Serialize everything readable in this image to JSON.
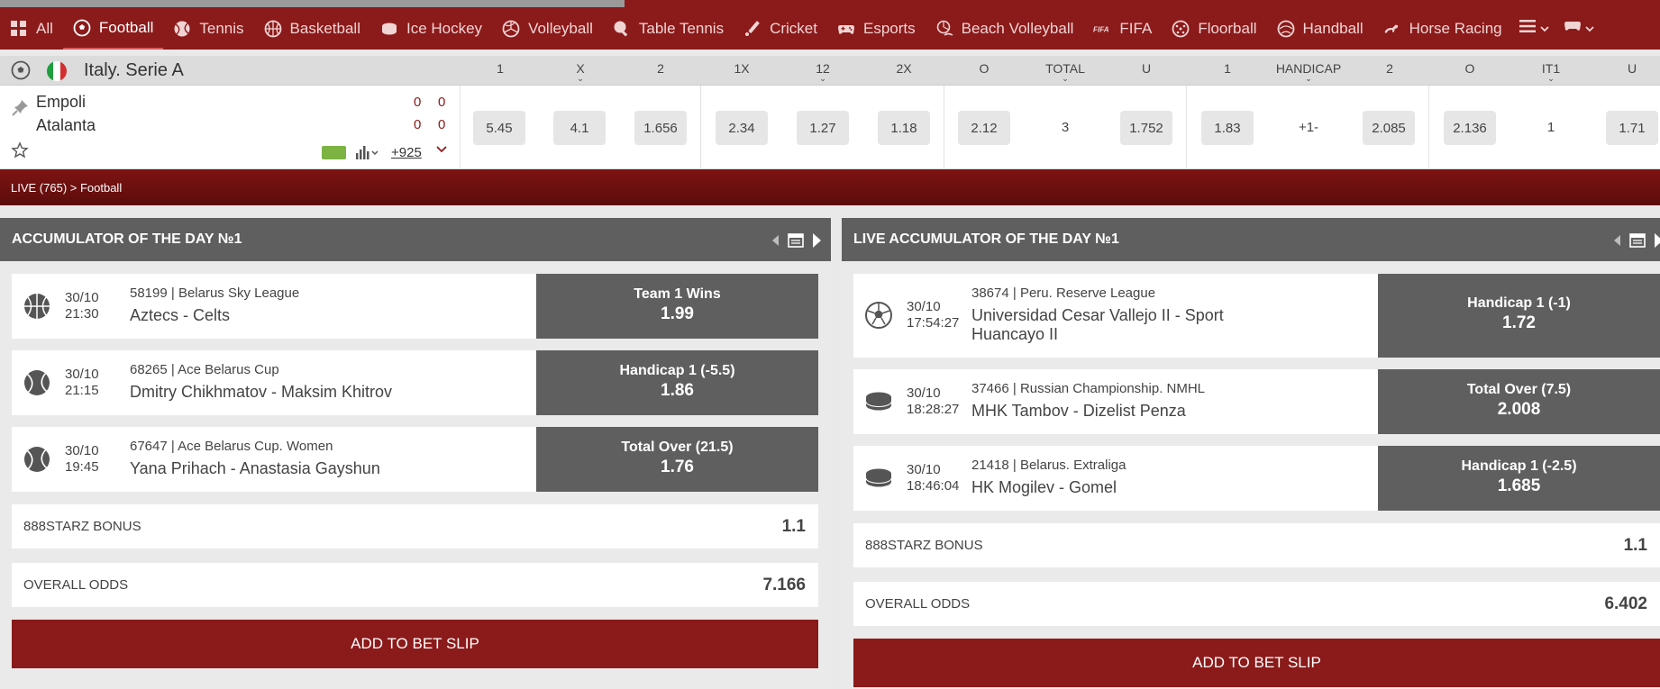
{
  "nav": {
    "items": [
      {
        "label": "All",
        "icon": "grid-icon"
      },
      {
        "label": "Football",
        "icon": "football-icon",
        "active": true
      },
      {
        "label": "Tennis",
        "icon": "tennis-icon"
      },
      {
        "label": "Basketball",
        "icon": "basketball-icon"
      },
      {
        "label": "Ice Hockey",
        "icon": "hockey-puck-icon"
      },
      {
        "label": "Volleyball",
        "icon": "volleyball-icon"
      },
      {
        "label": "Table Tennis",
        "icon": "table-tennis-icon"
      },
      {
        "label": "Cricket",
        "icon": "cricket-icon"
      },
      {
        "label": "Esports",
        "icon": "gamepad-icon"
      },
      {
        "label": "Beach Volleyball",
        "icon": "beach-volleyball-icon"
      },
      {
        "label": "FIFA",
        "icon": "fifa-icon"
      },
      {
        "label": "Floorball",
        "icon": "floorball-icon"
      },
      {
        "label": "Handball",
        "icon": "handball-icon"
      },
      {
        "label": "Horse Racing",
        "icon": "horse-icon"
      }
    ],
    "fifa_text": "FIFA"
  },
  "match_header": {
    "league": "Italy. Serie A",
    "columns": [
      "1",
      "X",
      "2",
      "1X",
      "12",
      "2X",
      "O",
      "TOTAL",
      "U",
      "1",
      "HANDICAP",
      "2",
      "O",
      "IT1",
      "U"
    ]
  },
  "match": {
    "team1": "Empoli",
    "team2": "Atalanta",
    "score1": [
      "0",
      "0"
    ],
    "score2": [
      "0",
      "0"
    ],
    "more_markets": "+925",
    "odds": [
      "5.45",
      "4.1",
      "1.656",
      "2.34",
      "1.27",
      "1.18",
      "2.12",
      "3",
      "1.752",
      "1.83",
      "+1-",
      "2.085",
      "2.136",
      "1",
      "1.71"
    ]
  },
  "breadcrumb": "LIVE (765) > Football",
  "left_panel": {
    "title": "ACCUMULATOR OF THE DAY №1",
    "bets": [
      {
        "sport_icon": "basketball-icon",
        "date": "30/10",
        "time": "21:30",
        "league": "58199 | Belarus Sky League",
        "teams": "Aztecs - Celts",
        "bet_label": "Team 1 Wins",
        "bet_odd": "1.99"
      },
      {
        "sport_icon": "tennis-icon",
        "date": "30/10",
        "time": "21:15",
        "league": "68265 | Ace Belarus Cup",
        "teams": "Dmitry Chikhmatov - Maksim Khitrov",
        "bet_label": "Handicap 1 (-5.5)",
        "bet_odd": "1.86"
      },
      {
        "sport_icon": "tennis-icon",
        "date": "30/10",
        "time": "19:45",
        "league": "67647 | Ace Belarus Cup. Women",
        "teams": "Yana Prihach - Anastasia Gayshun",
        "bet_label": "Total Over (21.5)",
        "bet_odd": "1.76"
      }
    ],
    "bonus_label": "888STARZ BONUS",
    "bonus_value": "1.1",
    "overall_label": "OVERALL ODDS",
    "overall_value": "7.166",
    "add_label": "ADD TO BET SLIP"
  },
  "right_panel": {
    "title": "LIVE ACCUMULATOR OF THE DAY №1",
    "bets": [
      {
        "sport_icon": "football-icon",
        "date": "30/10",
        "time": "17:54:27",
        "league": "38674 | Peru. Reserve League",
        "teams": "Universidad Cesar Vallejo II - Sport Huancayo II",
        "bet_label": "Handicap 1 (-1)",
        "bet_odd": "1.72"
      },
      {
        "sport_icon": "hockey-puck-icon",
        "date": "30/10",
        "time": "18:28:27",
        "league": "37466 | Russian Championship. NMHL",
        "teams": "MHK Tambov - Dizelist Penza",
        "bet_label": "Total Over (7.5)",
        "bet_odd": "2.008"
      },
      {
        "sport_icon": "hockey-puck-icon",
        "date": "30/10",
        "time": "18:46:04",
        "league": "21418 | Belarus. Extraliga",
        "teams": "HK Mogilev - Gomel",
        "bet_label": "Handicap 1 (-2.5)",
        "bet_odd": "1.685"
      }
    ],
    "bonus_label": "888STARZ BONUS",
    "bonus_value": "1.1",
    "overall_label": "OVERALL ODDS",
    "overall_value": "6.402",
    "add_label": "ADD TO BET SLIP"
  },
  "colors": {
    "brand": "#8b1a1a",
    "panel_header": "#5f5f5f",
    "bet_button": "#5f5f5f"
  }
}
